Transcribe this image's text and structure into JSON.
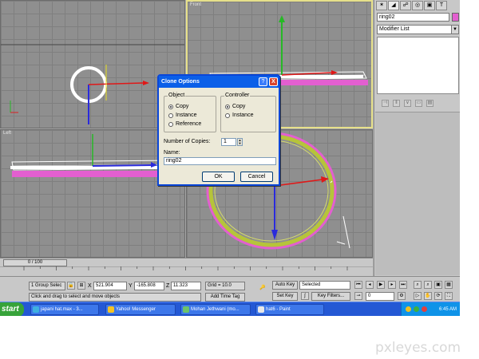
{
  "viewports": {
    "front_label": "Front",
    "left_label": "Left"
  },
  "command_panel": {
    "tabs": [
      "create-icon",
      "modify-icon",
      "hierarchy-icon",
      "motion-icon",
      "display-icon",
      "utilities-icon"
    ],
    "object_name": "ring02",
    "object_color": "#e35fd0",
    "modifier_list": "Modifier List"
  },
  "timeline": {
    "slider_label": "0 / 100",
    "ticks": [
      "10",
      "20",
      "30",
      "40",
      "50",
      "60",
      "70",
      "80",
      "90",
      "100"
    ],
    "first_tick": "0"
  },
  "status": {
    "selection": "1 Group Selec",
    "x_label": "X",
    "x_value": "521.904",
    "y_label": "Y",
    "y_value": "-165.808",
    "z_label": "Z",
    "z_value": "11.323",
    "grid": "Grid = 10.0",
    "prompt": "Click and drag to select and move objects",
    "add_time_tag": "Add Time Tag",
    "auto_key": "Auto Key",
    "set_key": "Set Key",
    "selected_option": "Selected",
    "key_filters": "Key Filters...",
    "frame_value": "0"
  },
  "dialog": {
    "title": "Clone Options",
    "help": "?",
    "close": "X",
    "object_group": "Object",
    "object_options": [
      "Copy",
      "Instance",
      "Reference"
    ],
    "controller_group": "Controller",
    "controller_options": [
      "Copy",
      "Instance"
    ],
    "copies_label": "Number of Copies:",
    "copies_value": "1",
    "name_label": "Name:",
    "name_value": "ring02",
    "ok": "OK",
    "cancel": "Cancel"
  },
  "taskbar": {
    "start": "start",
    "tasks": [
      {
        "label": "japani hat.max - 3...",
        "color": "#3fb0e0"
      },
      {
        "label": "Yahoo! Messenger",
        "color": "#f5c324"
      },
      {
        "label": "Mohan Jethwani (mo...",
        "color": "#6cc36a"
      },
      {
        "label": "hat6 - Paint",
        "color": "#e8e8e8"
      }
    ],
    "time": "6:45 AM"
  },
  "watermark": "pxleyes.com"
}
